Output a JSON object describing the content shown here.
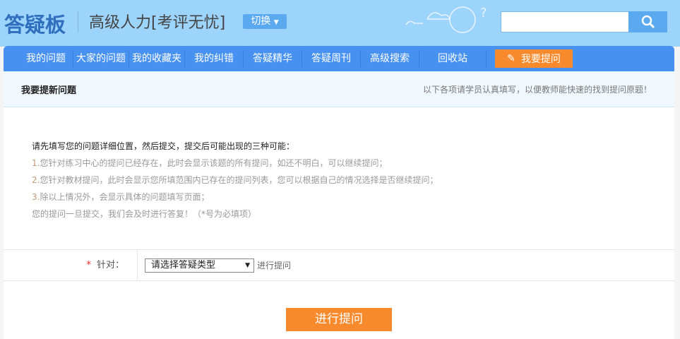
{
  "header": {
    "logo": "答疑板",
    "site_title": "高级人力[考评无忧]",
    "switch_label": "切换",
    "search_value": ""
  },
  "nav": {
    "items": [
      "我的问题",
      "大家的问题",
      "我的收藏夹",
      "我的纠错",
      "答疑精华",
      "答疑周刊",
      "高级搜索",
      "回收站"
    ],
    "ask_label": "我要提问"
  },
  "section": {
    "title": "我要提新问题",
    "hint": "以下各项请学员认真填写，以便教师能快速的找到提问原题！"
  },
  "info": {
    "intro": "请先填写您的问题详细位置，然后提交，提交后可能出现的三种可能：",
    "items": [
      {
        "num": "1.",
        "text": "您针对练习中心的提问已经存在，此时会显示该题的所有提问，如还不明白，可以继续提问；"
      },
      {
        "num": "2.",
        "text": "您针对教材提问，此时会显示您所填范围内已存在的提问列表，您可以根据自己的情况选择是否继续提问；"
      },
      {
        "num": "3.",
        "text": "除以上情况外，会显示具体的问题填写页面；"
      }
    ],
    "note": "您的提问一旦提交，我们会及时进行答复！（*号为必填项）"
  },
  "form": {
    "required_mark": "*",
    "label": "针对：",
    "select_value": "请选择答疑类型",
    "suffix": "进行提问",
    "submit_label": "进行提问"
  }
}
